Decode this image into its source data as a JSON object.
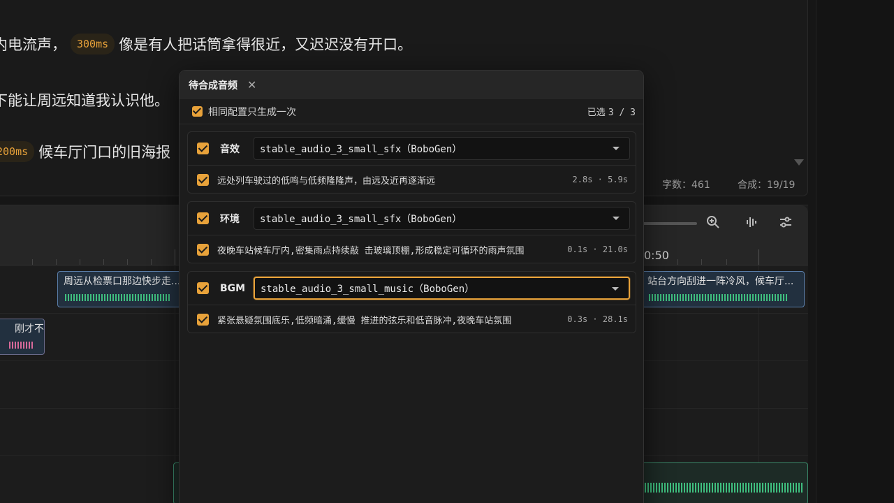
{
  "editor": {
    "line1": {
      "pre": "内电流声，",
      "chip": "300ms",
      "post": "像是有人把话筒拿得很近，又迟迟没有开口。"
    },
    "line2": {
      "text": "下能让周远知道我认识他。"
    },
    "line3": {
      "chip": "200ms",
      "post": "候车厅门口的旧海报"
    },
    "stats": {
      "word_count": "字数：461",
      "synth": "合成：19/19"
    }
  },
  "timeline": {
    "ruler_label": "0:50",
    "clips": [
      {
        "title": "周远从检票口那边快步走..."
      },
      {
        "title": "站台方向刮进一阵冷风，候车厅..."
      },
      {
        "title": "刚才不..."
      }
    ]
  },
  "modal": {
    "title": "待合成音频",
    "option_label": "相同配置只生成一次",
    "selected_prefix": "已选",
    "selected_value": "3 / 3",
    "groups": [
      {
        "name": "音效",
        "model": "stable_audio_3_small_sfx（BoboGen）",
        "description": "远处列车驶过的低鸣与低频隆隆声，由远及近再逐渐远",
        "timing": "2.8s · 5.9s"
      },
      {
        "name": "环境",
        "model": "stable_audio_3_small_sfx（BoboGen）",
        "description": "夜晚车站候车厅内,密集雨点持续敲 击玻璃顶棚,形成稳定可循环的雨声氛围",
        "timing": "0.1s · 21.0s"
      },
      {
        "name": "BGM",
        "model": "stable_audio_3_small_music（BoboGen）",
        "description": "紧张悬疑氛围底乐,低频暗涌,缓慢 推进的弦乐和低音脉冲,夜晚车站氛围",
        "timing": "0.3s · 28.1s"
      }
    ]
  },
  "colors": {
    "accent": "#e8a23a",
    "panel": "#1c1c1c",
    "header": "#262626"
  },
  "icons": [
    "close-icon",
    "zoom-in-icon",
    "waveform-icon",
    "sliders-icon",
    "chevron-down-icon"
  ]
}
